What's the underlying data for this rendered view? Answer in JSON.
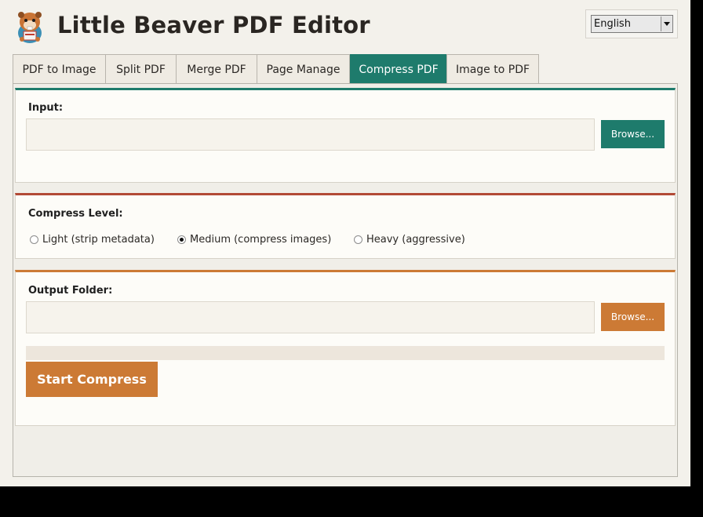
{
  "app": {
    "title": "Little Beaver PDF Editor"
  },
  "language": {
    "selected": "English"
  },
  "tabs": [
    {
      "label": "PDF to Image"
    },
    {
      "label": "Split PDF"
    },
    {
      "label": "Merge PDF"
    },
    {
      "label": "Page Manage"
    },
    {
      "label": "Compress PDF",
      "active": true
    },
    {
      "label": "Image to PDF"
    }
  ],
  "input_section": {
    "label": "Input:",
    "value": "",
    "browse_label": "Browse..."
  },
  "level_section": {
    "label": "Compress Level:",
    "options": [
      {
        "label": "Light (strip metadata)",
        "checked": false
      },
      {
        "label": "Medium (compress images)",
        "checked": true
      },
      {
        "label": "Heavy (aggressive)",
        "checked": false
      }
    ]
  },
  "output_section": {
    "label": "Output Folder:",
    "value": "",
    "browse_label": "Browse...",
    "progress": 0,
    "start_label": "Start Compress"
  },
  "colors": {
    "teal": "#1e7b6c",
    "red": "#b24a36",
    "orange": "#cc7a35",
    "background": "#f3f1eb"
  }
}
